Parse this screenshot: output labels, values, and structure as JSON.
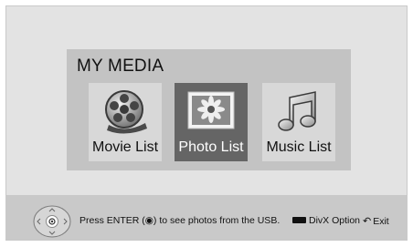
{
  "screen_title": "MY MEDIA",
  "tiles": [
    {
      "label": "Movie List",
      "icon": "film-reel-icon",
      "selected": false
    },
    {
      "label": "Photo List",
      "icon": "photo-icon",
      "selected": true
    },
    {
      "label": "Music List",
      "icon": "music-note-icon",
      "selected": false
    }
  ],
  "help": {
    "nav_icon": "navigation-dpad-icon",
    "text": "Press ENTER (◉) to see photos from the USB."
  },
  "buttons": {
    "divx_label": "DivX Option",
    "divx_icon": "black-key-icon",
    "exit_label": "Exit",
    "exit_icon": "return-arrow-icon"
  },
  "colors": {
    "background": "#e3e3e3",
    "panel": "#c3c3c3",
    "tile": "#d8d8d8",
    "tile_selected": "#656565",
    "bottom_bar": "#c9c9c9"
  }
}
